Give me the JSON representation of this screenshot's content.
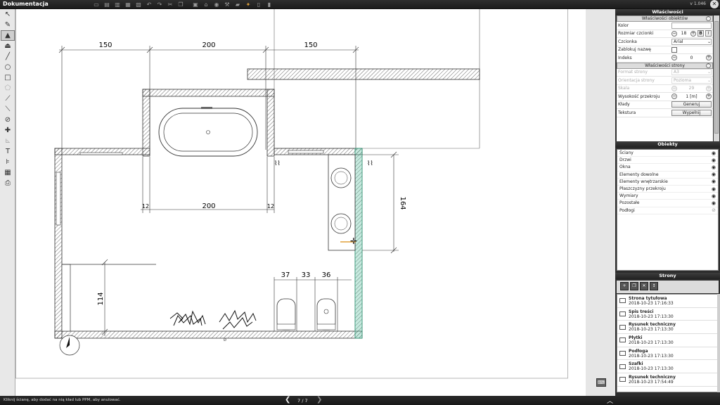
{
  "app": {
    "title": "Dokumentacja",
    "version": "v 1.046",
    "close_icon": "✕"
  },
  "top_tools": [
    {
      "name": "new-doc-icon",
      "glyph": "▭"
    },
    {
      "name": "open-icon",
      "glyph": "▤"
    },
    {
      "name": "save-icon",
      "glyph": "▥"
    },
    {
      "name": "print-icon",
      "glyph": "▦"
    },
    {
      "name": "export-icon",
      "glyph": "▧"
    },
    {
      "name": "undo-icon",
      "glyph": "↶"
    },
    {
      "name": "redo-icon",
      "glyph": "↷"
    },
    {
      "name": "scissors-icon",
      "glyph": "✂"
    },
    {
      "name": "copy-icon",
      "glyph": "❐"
    },
    {
      "name": "paste-icon",
      "glyph": "▣"
    },
    {
      "name": "tool-a-icon",
      "glyph": "⌂"
    },
    {
      "name": "tool-b-icon",
      "glyph": "◉"
    },
    {
      "name": "tool-c-icon",
      "glyph": "⚒"
    },
    {
      "name": "tool-d-icon",
      "glyph": "▰"
    },
    {
      "name": "tool-e-icon",
      "glyph": "✦"
    },
    {
      "name": "tool-f-icon",
      "glyph": "▯"
    },
    {
      "name": "tool-g-icon",
      "glyph": "▮"
    }
  ],
  "left_tools": [
    {
      "name": "select-tool-icon",
      "glyph": "↖"
    },
    {
      "name": "edit-tool-icon",
      "glyph": "✎"
    },
    {
      "name": "wall-tool-icon",
      "glyph": "▲"
    },
    {
      "name": "section-tool-icon",
      "glyph": "⏏"
    },
    {
      "name": "line-tool-icon",
      "glyph": "╱"
    },
    {
      "name": "circle-tool-icon",
      "glyph": "○"
    },
    {
      "name": "rectangle-tool-icon",
      "glyph": "□"
    },
    {
      "name": "polygon-tool-icon",
      "glyph": "⬠"
    },
    {
      "name": "dimension-tool-icon",
      "glyph": "⟋"
    },
    {
      "name": "measure-tool-icon",
      "glyph": "⟍"
    },
    {
      "name": "angle-tool-icon",
      "glyph": "⊘"
    },
    {
      "name": "arrow-tool-icon",
      "glyph": "✚"
    },
    {
      "name": "coords-tool-icon",
      "glyph": "⊾"
    },
    {
      "name": "text-tool-icon",
      "glyph": "T"
    },
    {
      "name": "label-tool-icon",
      "glyph": "⊧"
    },
    {
      "name": "table-tool-icon",
      "glyph": "▦"
    },
    {
      "name": "print-tool-icon",
      "glyph": "⎙"
    }
  ],
  "drawing": {
    "dims": [
      "150",
      "200",
      "150",
      "200",
      "12",
      "12",
      "164",
      "37",
      "33",
      "36",
      "114"
    ]
  },
  "status": {
    "text": "Kliknij ścianę, aby dodać na nią kład lub PPM, aby anulować.",
    "page": "7 / 7",
    "prev": "❮",
    "next": "❯",
    "collapse": "︿"
  },
  "right_panel": {
    "header": "Właściwości",
    "obj_props": {
      "title": "Właściwości obiektów",
      "kolor_label": "Kolor",
      "font_size_label": "Rozmiar czcionki",
      "font_size": "18",
      "bold": "B",
      "italic": "I",
      "font_label": "Czcionka",
      "font": "Arial",
      "lock_label": "Zablokuj nazwę",
      "index_label": "Indeks",
      "index": "0"
    },
    "page_props": {
      "title": "Właściwości strony",
      "format_label": "Format strony",
      "format": "A3",
      "orient_label": "Orientacja strony",
      "orient": "Pozioma",
      "scale_label": "Skala",
      "scale": "29",
      "height_label": "Wysokość przekroju",
      "height": "1 [m]",
      "klady_label": "Kłady",
      "klady_btn": "Generuj",
      "texture_label": "Tekstura",
      "texture_btn": "Wypełnij"
    },
    "objects_header": "Obiekty",
    "objects": [
      {
        "label": "Ściany",
        "visible": true
      },
      {
        "label": "Drzwi",
        "visible": true
      },
      {
        "label": "Okna",
        "visible": true
      },
      {
        "label": "Elementy dowolne",
        "visible": true
      },
      {
        "label": "Elementy wnętrzarskie",
        "visible": true
      },
      {
        "label": "Płaszczyzny przekroju",
        "visible": true
      },
      {
        "label": "Wymiary",
        "visible": true
      },
      {
        "label": "Pozostałe",
        "visible": true
      },
      {
        "label": "Podłogi",
        "visible": false
      }
    ],
    "pages_header": "Strony",
    "pages": [
      {
        "name": "Strona tytułowa",
        "date": "2018-10-23 17:16:33"
      },
      {
        "name": "Spis treści",
        "date": "2018-10-23 17:13:30"
      },
      {
        "name": "Rysunek techniczny",
        "date": "2018-10-23 17:13:30"
      },
      {
        "name": "Płytki",
        "date": "2018-10-23 17:13:30"
      },
      {
        "name": "Podłoga",
        "date": "2018-10-23 17:13:30"
      },
      {
        "name": "Szafki",
        "date": "2018-10-23 17:13:30"
      },
      {
        "name": "Rysunek techniczny",
        "date": "2018-10-23 17:54:49"
      }
    ]
  }
}
